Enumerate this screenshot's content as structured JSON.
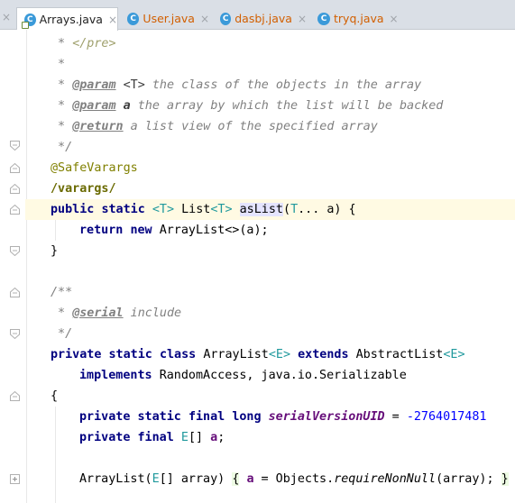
{
  "tabs": [
    {
      "label": "Arrays.java",
      "icon": "class-icon",
      "active": true
    },
    {
      "label": "User.java",
      "icon": "class-icon",
      "active": false
    },
    {
      "label": "dasbj.java",
      "icon": "class-icon",
      "active": false
    },
    {
      "label": "tryq.java",
      "icon": "class-icon",
      "active": false
    }
  ],
  "close_glyph": "×",
  "code": {
    "l1": {
      "a": " * ",
      "b": "</pre>"
    },
    "l2": {
      "a": " *"
    },
    "l3": {
      "a": " * ",
      "tag": "@param",
      "b": " ",
      "c": "<T>",
      "d": " the class of the objects in the array"
    },
    "l4": {
      "a": " * ",
      "tag": "@param",
      "b": " ",
      "c": "a",
      "d": " the array by which the list will be backed"
    },
    "l5": {
      "a": " * ",
      "tag": "@return",
      "d": " a list view of the specified array"
    },
    "l6": {
      "a": " */"
    },
    "l7": {
      "an": "@SafeVarargs"
    },
    "l8": {
      "an": "/varargs/"
    },
    "l9": {
      "kw1": "public",
      "kw2": "static",
      "t1": "<T>",
      "t2": "List",
      "t3": "<T>",
      "m": "asList",
      "p1": "(",
      "t4": "T",
      "p2": "... a) {"
    },
    "l10": {
      "kw1": "return",
      "kw2": "new",
      "t": "ArrayList<>(a);"
    },
    "l11": {
      "t": "}"
    },
    "l12": {
      "t": "/**"
    },
    "l13": {
      "a": " * ",
      "tag": "@serial",
      "d": " include"
    },
    "l14": {
      "a": " */"
    },
    "l15": {
      "kw1": "private",
      "kw2": "static",
      "kw3": "class",
      "t1": "ArrayList",
      "t2": "<E>",
      "kw4": "extends",
      "t3": "AbstractList",
      "t4": "<E>"
    },
    "l16": {
      "kw": "implements",
      "t": "RandomAccess, java.io.Serializable"
    },
    "l17": {
      "t": "{"
    },
    "l18": {
      "kw1": "private",
      "kw2": "static",
      "kw3": "final",
      "kw4": "long",
      "f": "serialVersionUID",
      "eq": " = ",
      "n": "-2764017481"
    },
    "l19": {
      "kw1": "private",
      "kw2": "final",
      "t": "E",
      "t2": "[] ",
      "f": "a",
      "semi": ";"
    },
    "l20": {
      "t1": "ArrayList(",
      "t2": "E",
      "t3": "[] array) ",
      "o": "{",
      "f": "a",
      "eq": " = Objects.",
      "m": "requireNonNull",
      "r": "(array); ",
      "c": "}"
    }
  }
}
